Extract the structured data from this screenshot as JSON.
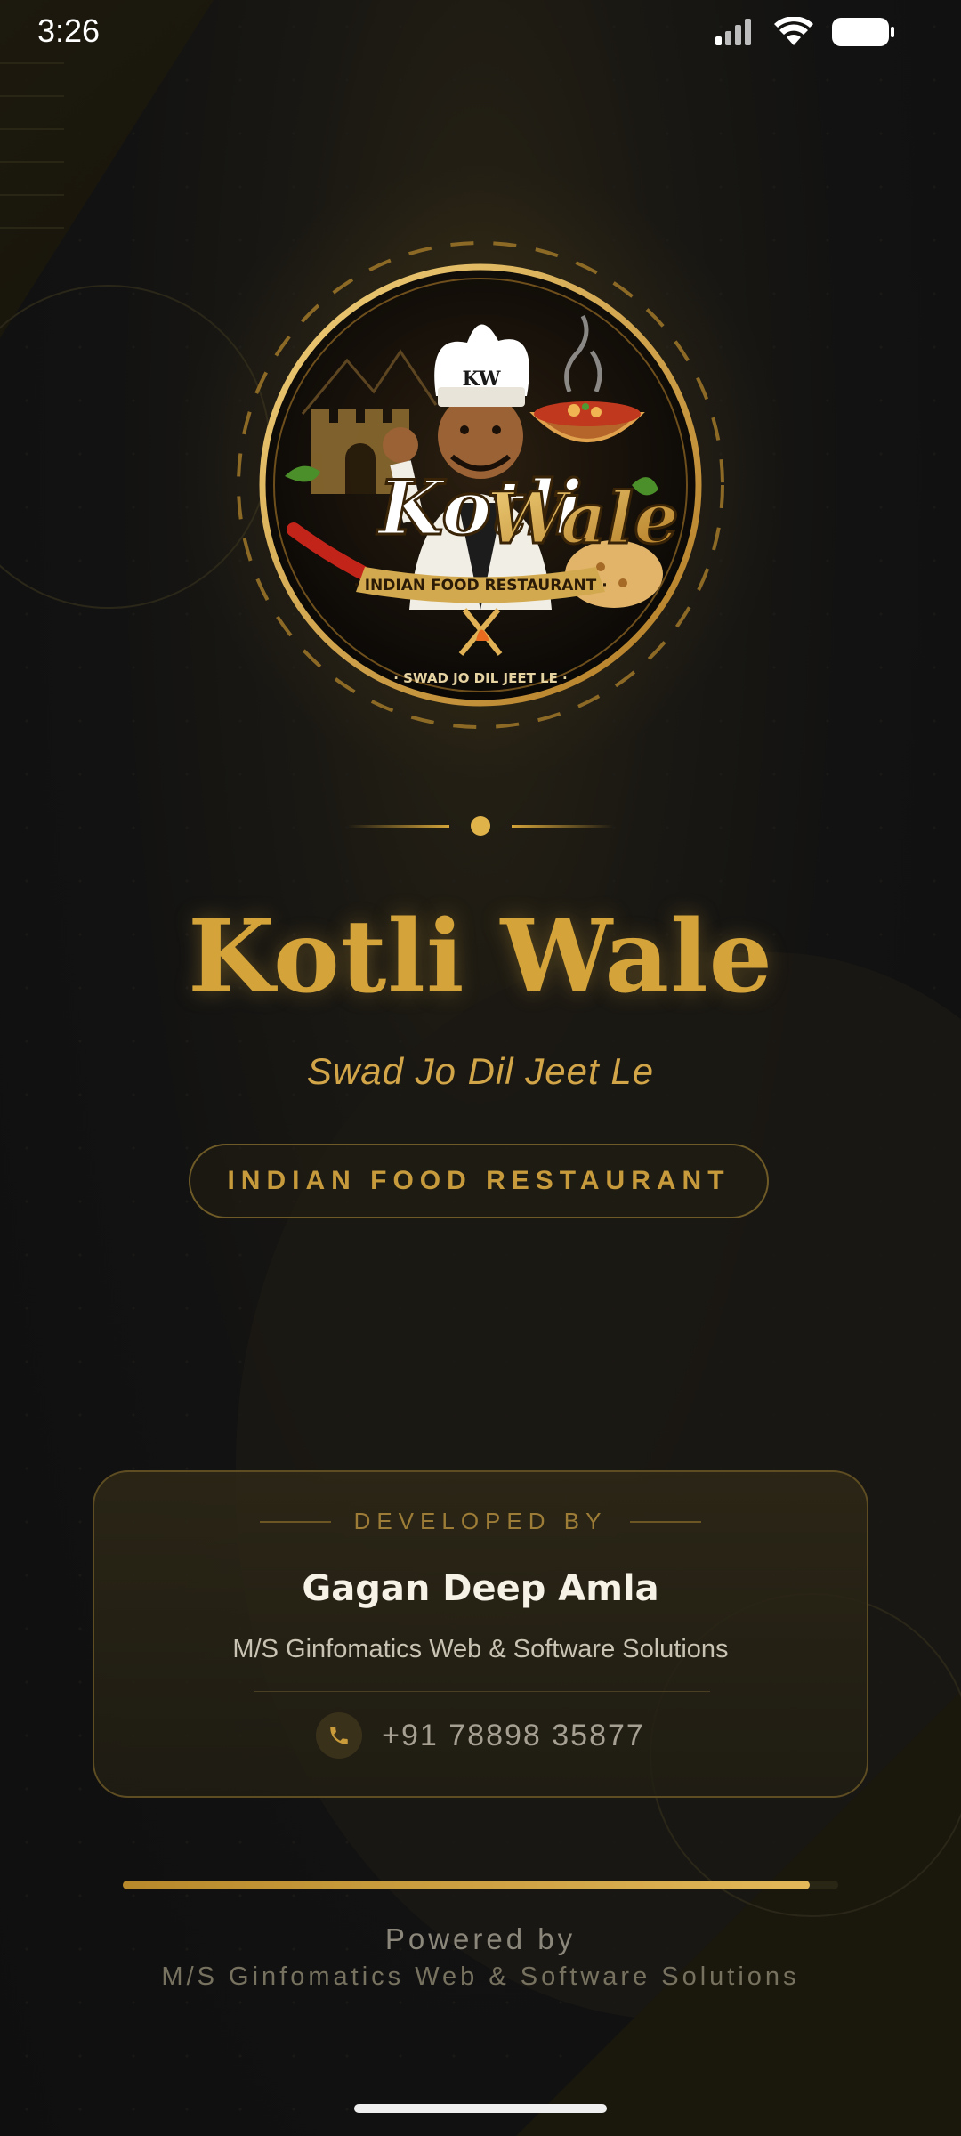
{
  "status_bar": {
    "time": "3:26"
  },
  "logo": {
    "icon": "chef-logo-icon",
    "lettering": [
      "Kotli Wale",
      "INDIAN FOOD RESTAURANT",
      "SWAD JO DIL JEET LE",
      "KW"
    ]
  },
  "brand": {
    "title": "Kotli Wale",
    "tagline": "Swad Jo Dil Jeet Le",
    "category": "INDIAN FOOD RESTAURANT"
  },
  "developer": {
    "label": "DEVELOPED BY",
    "name": "Gagan Deep Amla",
    "company": "M/S Ginfomatics Web & Software Solutions",
    "phone": "+91 78898 35877",
    "phone_icon": "phone-icon"
  },
  "loading": {
    "progress": 0.96
  },
  "footer": {
    "powered_by": "Powered by",
    "company": "M/S Ginfomatics Web & Software Solutions"
  },
  "colors": {
    "gold": "#d4a43a",
    "background": "#111111",
    "card_border": "#5e4d22"
  }
}
